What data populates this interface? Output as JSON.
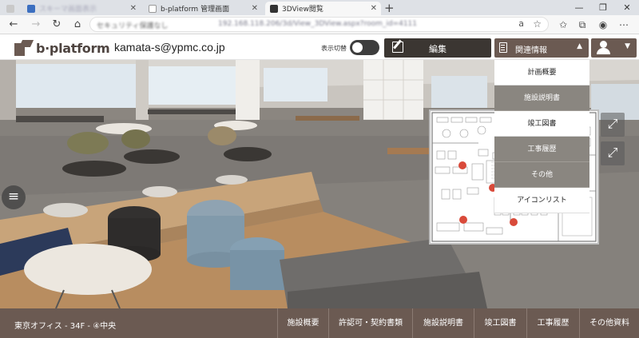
{
  "browser": {
    "tabs": [
      {
        "label": "スキーマ画面表示",
        "blurred": true,
        "active": false
      },
      {
        "label": "b-platform 管理画面",
        "blurred": false,
        "active": false
      },
      {
        "label": "3DView閲覧",
        "blurred": false,
        "active": true
      }
    ],
    "address": {
      "site_info": "セキュリティ保護なし",
      "url": "192.168.118.206/3d/View_3DView.aspx?room_id=4111"
    }
  },
  "header": {
    "logo_text": "b·platform",
    "user_email": "kamata-s@ypmc.co.jp",
    "toggle_label": "表示切替",
    "edit_label": "編集",
    "related_label": "関連情報"
  },
  "dropdown": {
    "items": [
      {
        "label": "計画概要",
        "style": "plain"
      },
      {
        "label": "施設説明書",
        "style": "alt"
      },
      {
        "label": "竣工図書",
        "style": "plain"
      },
      {
        "label": "工事履歴",
        "style": "alt"
      },
      {
        "label": "その他",
        "style": "alt"
      },
      {
        "label": "アイコンリスト",
        "style": "plain"
      }
    ]
  },
  "minimap": {
    "marker_color": "#d94a3a",
    "markers": 6
  },
  "footer": {
    "location": "東京オフィス - 34F - ④中央",
    "nav": [
      "施設概要",
      "許認可・契約書類",
      "施設説明書",
      "竣工図書",
      "工事履歴",
      "その他資料"
    ]
  },
  "colors": {
    "brand": "#6b5a52",
    "edit_button": "#3b3632",
    "menu_alt": "#8a8680"
  }
}
